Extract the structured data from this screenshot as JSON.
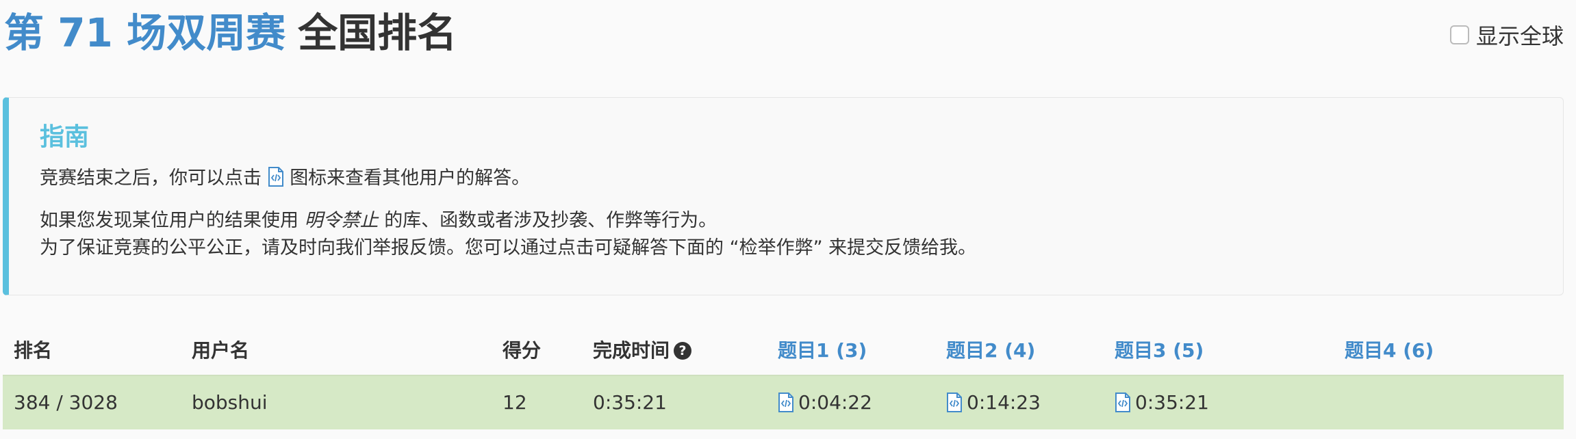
{
  "header": {
    "contest_name": "第 71 场双周赛",
    "suffix": "全国排名",
    "global_toggle_label": "显示全球"
  },
  "guide": {
    "title": "指南",
    "line1_before": "竞赛结束之后，你可以点击",
    "line1_after": "图标来查看其他用户的解答。",
    "line2_before": "如果您发现某位用户的结果使用",
    "line2_em": "明令禁止",
    "line2_after": "的库、函数或者涉及抄袭、作弊等行为。",
    "line3": "为了保证竞赛的公平公正，请及时向我们举报反馈。您可以通过点击可疑解答下面的 “检举作弊” 来提交反馈给我。"
  },
  "table": {
    "headers": {
      "rank": "排名",
      "username": "用户名",
      "score": "得分",
      "finish_time": "完成时间",
      "q1": "题目1 (3)",
      "q2": "题目2 (4)",
      "q3": "题目3 (5)",
      "q4": "题目4 (6)"
    },
    "rows": [
      {
        "rank": "384 / 3028",
        "username": "bobshui",
        "score": "12",
        "finish_time": "0:35:21",
        "q1": "0:04:22",
        "q2": "0:14:23",
        "q3": "0:35:21",
        "q4": ""
      }
    ]
  },
  "colors": {
    "link_blue": "#428bca",
    "info_blue": "#5bc0de",
    "success_row": "#d6e9c6"
  },
  "icons": {
    "solution": "code-file-icon",
    "help": "question-circle-icon"
  }
}
